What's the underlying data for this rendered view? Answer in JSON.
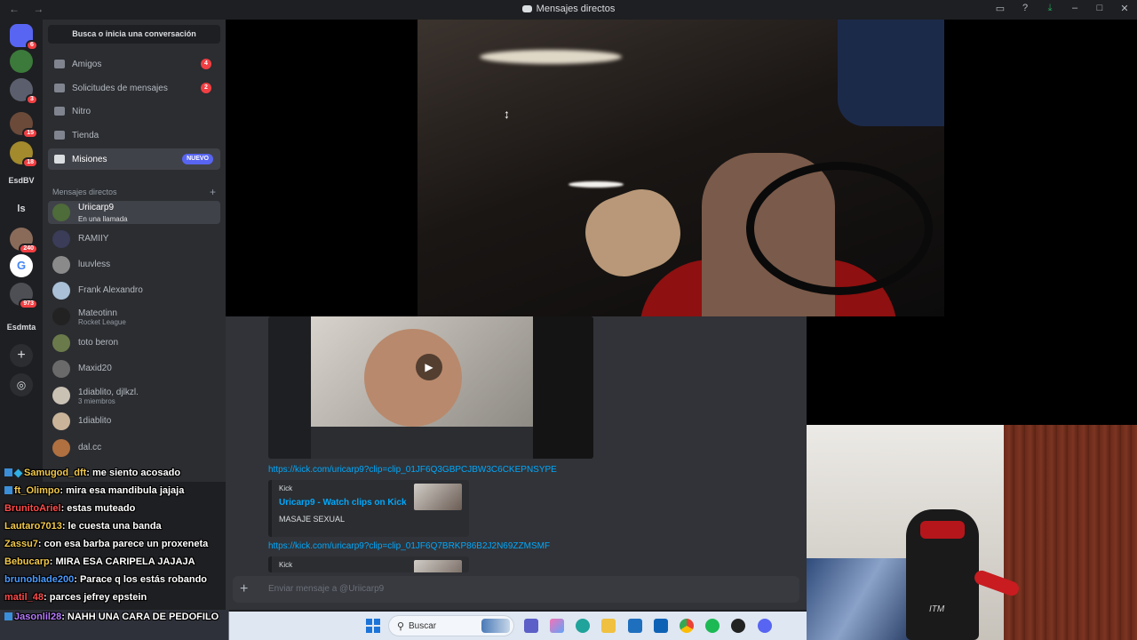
{
  "titlebar": {
    "title": "Mensajes directos",
    "nav": "← →",
    "icons": [
      "inbox-icon",
      "help-icon",
      "download-icon",
      "minimize-icon",
      "maximize-icon",
      "close-icon"
    ]
  },
  "servers": [
    {
      "name": "home",
      "badge": "6"
    },
    {
      "name": "server-1",
      "badge": ""
    },
    {
      "name": "server-2",
      "badge": "3"
    },
    {
      "name": "server-3",
      "badge": "15"
    },
    {
      "name": "server-4",
      "badge": "18"
    },
    {
      "name": "EsdBV",
      "label": "EsdBV"
    },
    {
      "name": "ls",
      "label": "ls"
    },
    {
      "name": "server-7",
      "badge": "240"
    },
    {
      "name": "server-8",
      "badge": ""
    },
    {
      "name": "server-9",
      "badge": "973"
    },
    {
      "name": "Esdmta",
      "label": "Esdmta"
    }
  ],
  "sidebar": {
    "search_placeholder": "Busca o inicia una conversación",
    "nav": [
      {
        "label": "Amigos",
        "count": "4"
      },
      {
        "label": "Solicitudes de mensajes",
        "count": "2"
      },
      {
        "label": "Nitro",
        "count": ""
      },
      {
        "label": "Tienda",
        "count": ""
      },
      {
        "label": "Misiones",
        "tag": "NUEVO"
      }
    ],
    "dm_header": "Mensajes directos",
    "dms": [
      {
        "name": "Uriicarp9",
        "sub": "En una llamada"
      },
      {
        "name": "RAMIIY",
        "sub": ""
      },
      {
        "name": "luuvless",
        "sub": ""
      },
      {
        "name": "Frank Alexandro",
        "sub": ""
      },
      {
        "name": "Mateotinn",
        "sub": "Rocket League"
      },
      {
        "name": "toto beron",
        "sub": ""
      },
      {
        "name": "Maxid20",
        "sub": ""
      },
      {
        "name": "1diablito, djlkzl.",
        "sub": "3 miembros"
      },
      {
        "name": "1diablito",
        "sub": ""
      },
      {
        "name": "dal.cc",
        "sub": ""
      }
    ]
  },
  "chat": {
    "link1": "https://kick.com/uricarp9?clip=clip_01JF6Q3GBPCJBW3C6CKEPNSYPE",
    "embed": {
      "provider": "Kick",
      "title": "Uricarp9 - Watch clips on Kick",
      "description": "MASAJE SEXUAL"
    },
    "link2": "https://kick.com/uricarp9?clip=clip_01JF6Q7BRKP86B2J2N69ZZMSMF",
    "embed2_provider": "Kick",
    "composer_placeholder": "Enviar mensaje a @Uriicarp9"
  },
  "taskbar": {
    "search_label": "Buscar"
  },
  "stream_chat": [
    {
      "user": "Samugod_dft",
      "color": "#f2c94c",
      "msg": ": me siento acosado",
      "badges": 2
    },
    {
      "user": "ft_Olimpo",
      "color": "#f2c94c",
      "msg": ": mira esa mandibula jajaja",
      "badges": 1
    },
    {
      "user": "BrunitoAriel",
      "color": "#ff4b4b",
      "msg": ": estas muteado",
      "badges": 0
    },
    {
      "user": "Lautaro7013",
      "color": "#f2c94c",
      "msg": ": le cuesta una banda",
      "badges": 0
    },
    {
      "user": "Zassu7",
      "color": "#f2c94c",
      "msg": ": con esa barba parece un proxeneta",
      "badges": 0
    },
    {
      "user": "Bebucarp",
      "color": "#f2c94c",
      "msg": ": MIRA ESA CARIPELA JAJAJA",
      "badges": 0
    },
    {
      "user": "brunoblade200",
      "color": "#4b9bff",
      "msg": ": Parace q los estás robando",
      "badges": 0
    },
    {
      "user": "matil_48",
      "color": "#ff4b4b",
      "msg": ": parces jefrey epstein",
      "badges": 0
    }
  ],
  "stream_last": {
    "user": "Jasonlil28",
    "color": "#b57bff",
    "msg": ": NAHH UNA CARA DE PEDOFILO"
  }
}
